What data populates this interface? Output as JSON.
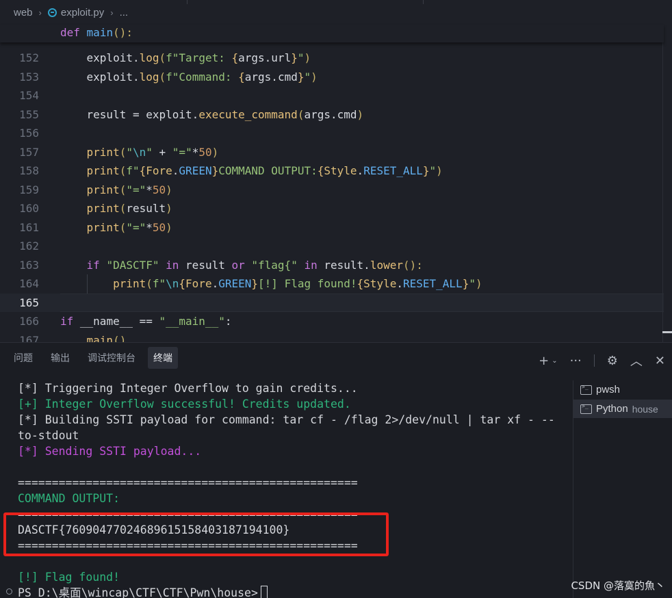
{
  "breadcrumb": {
    "folder": "web",
    "file": "exploit.py",
    "more": "..."
  },
  "sticky_scroll": {
    "line": "def main():"
  },
  "editor": {
    "lines": [
      {
        "n": "152"
      },
      {
        "n": "153"
      },
      {
        "n": "154"
      },
      {
        "n": "155"
      },
      {
        "n": "156"
      },
      {
        "n": "157"
      },
      {
        "n": "158"
      },
      {
        "n": "159"
      },
      {
        "n": "160"
      },
      {
        "n": "161"
      },
      {
        "n": "162"
      },
      {
        "n": "163"
      },
      {
        "n": "164"
      },
      {
        "n": "165"
      },
      {
        "n": "166"
      },
      {
        "n": "167"
      }
    ]
  },
  "panel": {
    "tabs": [
      "问题",
      "输出",
      "调试控制台",
      "终端"
    ],
    "active_tab": "终端",
    "actions": {
      "add": "+",
      "dropdown": "⌄",
      "more": "···",
      "settings": "⚙",
      "maximize": "︿",
      "close": "✕"
    }
  },
  "terminal": {
    "lines": [
      {
        "text": "[*] Triggering Integer Overflow to gain credits...",
        "color": "white"
      },
      {
        "text": "[+] Integer Overflow successful! Credits updated.",
        "color": "green"
      },
      {
        "text": "[*] Building SSTI payload for command: tar cf - /flag 2>/dev/null | tar xf - --",
        "color": "white"
      },
      {
        "text": "to-stdout",
        "color": "white"
      },
      {
        "text": "[*] Sending SSTI payload...",
        "color": "magenta"
      },
      {
        "text": "",
        "color": "white"
      },
      {
        "text": "==================================================",
        "color": "white"
      },
      {
        "text": "COMMAND OUTPUT:",
        "color": "green"
      },
      {
        "text": "==================================================",
        "color": "white"
      },
      {
        "text": "DASCTF{76090477024689615158403187194100}",
        "color": "white"
      },
      {
        "text": "==================================================",
        "color": "white"
      },
      {
        "text": "",
        "color": "white"
      },
      {
        "text": "[!] Flag found!",
        "color": "green"
      }
    ],
    "prompt": "PS D:\\桌面\\wincap\\CTF\\CTF\\Pwn\\house>"
  },
  "terminal_list": {
    "items": [
      {
        "name": "pwsh",
        "sub": ""
      },
      {
        "name": "Python",
        "sub": "house"
      }
    ]
  },
  "watermark": "CSDN @落寞的魚丶",
  "colors": {
    "highlight_box": "#e8221b",
    "green": "#2fb47c",
    "magenta": "#c050d8"
  }
}
